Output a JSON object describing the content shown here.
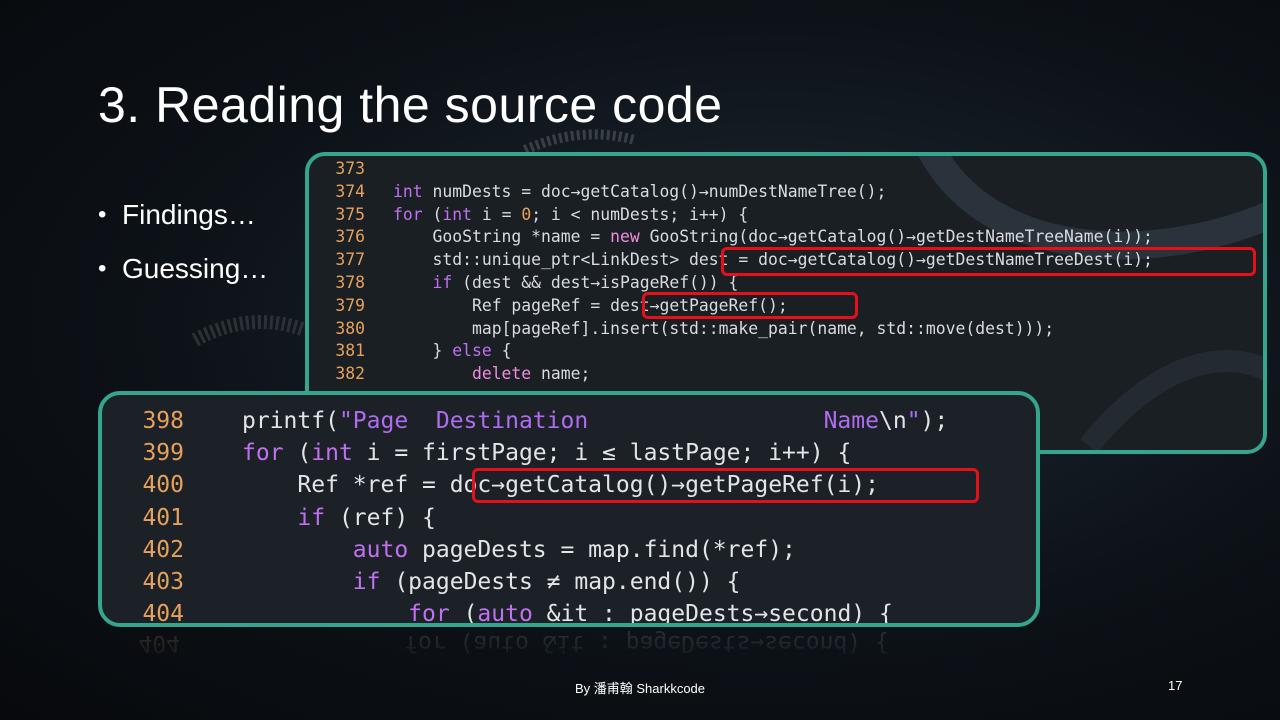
{
  "slide": {
    "title": "3. Reading the source code",
    "bullets": [
      "Findings…",
      "Guessing…"
    ],
    "footer": "By 潘甫翰 Sharkkcode",
    "page_number": "17"
  },
  "code_top": {
    "lines": [
      {
        "n": "373"
      },
      {
        "n": "374"
      },
      {
        "n": "375"
      },
      {
        "n": "376"
      },
      {
        "n": "377"
      },
      {
        "n": "378"
      },
      {
        "n": "379"
      },
      {
        "n": "380"
      },
      {
        "n": "381"
      },
      {
        "n": "382"
      }
    ],
    "t374": {
      "a": "int",
      "b": " numDests = doc→getCatalog()→numDestNameTree();"
    },
    "t375": {
      "a": "for",
      "b": " (",
      "c": "int",
      "d": " i = ",
      "e": "0",
      "f": "; i < numDests; i++) {"
    },
    "t376": {
      "a": "GooString *name = ",
      "b": "new",
      "c": " GooString(doc→getCatalog()→getDestNameTreeName(i));"
    },
    "t377": {
      "a": "std::unique_ptr<LinkDest> dest = doc→getCatalog()→getDestNameTreeDest(i);"
    },
    "t378": {
      "a": "if",
      "b": " (dest && dest→isPageRef()) {"
    },
    "t379": {
      "a": "Ref pageRef = dest→getPageRef();"
    },
    "t380": {
      "a": "map[pageRef].insert(std::make_pair(name, std::move(dest)));"
    },
    "t381": {
      "a": "} ",
      "b": "else",
      "c": " {"
    },
    "t382": {
      "a": "delete",
      "b": " name;"
    }
  },
  "code_bottom": {
    "lines": [
      {
        "n": "398"
      },
      {
        "n": "399"
      },
      {
        "n": "400"
      },
      {
        "n": "401"
      },
      {
        "n": "402"
      },
      {
        "n": "403"
      },
      {
        "n": "404"
      }
    ],
    "t398": {
      "a": "printf(",
      "b": "\"Page  Destination                 Name",
      "c": "\\n",
      "d": "\"",
      "e": ");"
    },
    "t399": {
      "a": "for",
      "b": " (",
      "c": "int",
      "d": " i = firstPage; i ≤ lastPage; i++) {"
    },
    "t400": {
      "a": "Ref *ref = doc→getCatalog()→getPageRef(i);"
    },
    "t401": {
      "a": "if",
      "b": " (ref) {"
    },
    "t402": {
      "a": "auto",
      "b": " pageDests = map.find(*ref);"
    },
    "t403": {
      "a": "if",
      "b": " (pageDests ≠ map.end()) {"
    },
    "t404": {
      "a": "for",
      "b": " (",
      "c": "auto",
      "d": " &it : pageDests→second) {"
    }
  },
  "colors": {
    "panel_border": "#35a58e",
    "highlight_border": "#e5101a",
    "line_number": "#e7a15a",
    "keyword": "#c070f0"
  }
}
